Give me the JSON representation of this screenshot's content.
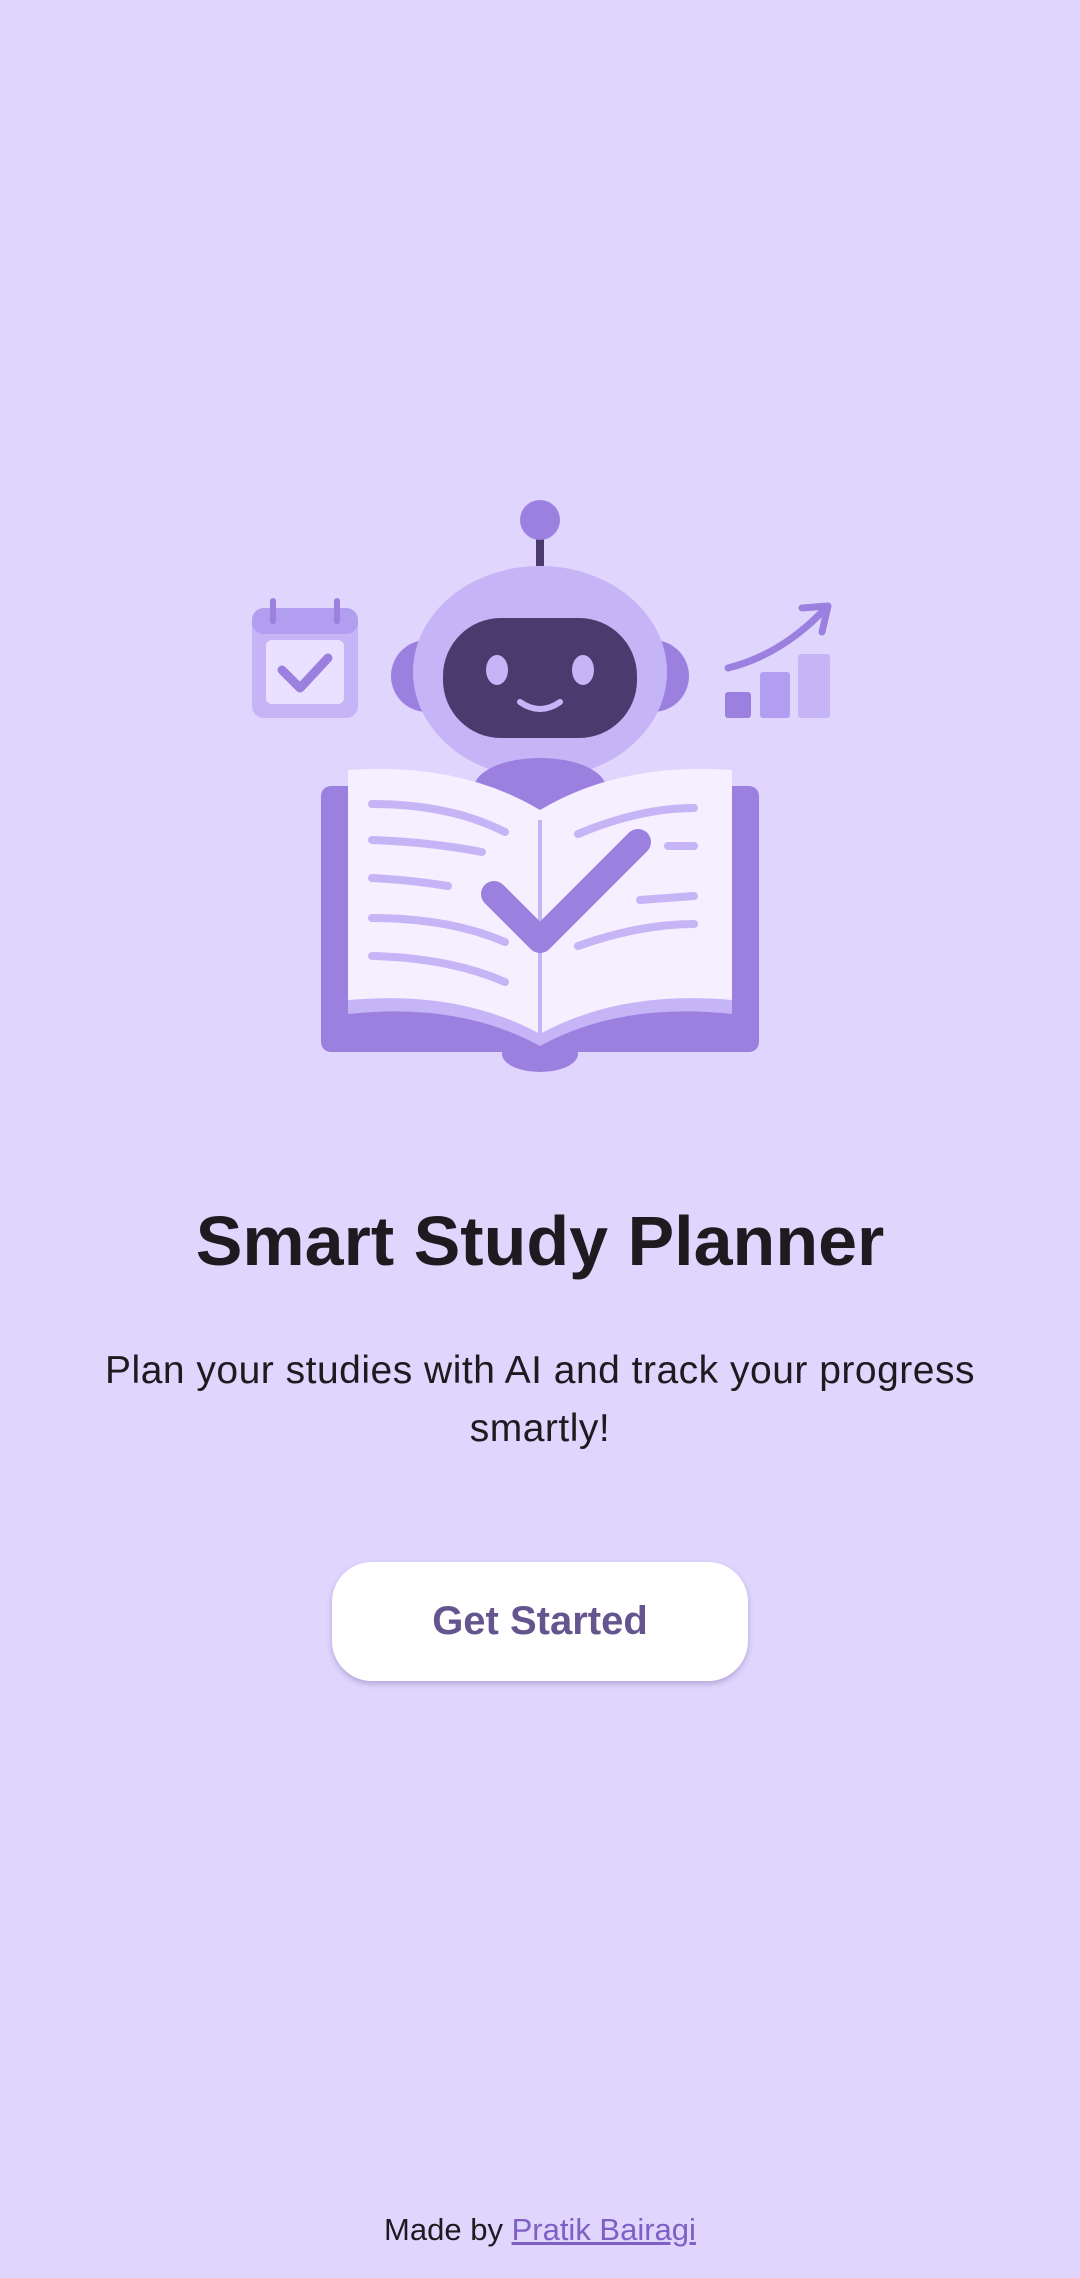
{
  "hero": {
    "icon": "robot-reading-book-illustration"
  },
  "title": "Smart Study Planner",
  "subtitle": "Plan your studies with AI and track your progress smartly!",
  "cta": {
    "label": "Get Started"
  },
  "footer": {
    "prefix": "Made by",
    "author": "Pratik Bairagi"
  },
  "colors": {
    "background": "#dfd5fd",
    "primary": "#65558f",
    "illustration_light": "#c5b5f6",
    "illustration_mid": "#9b80e0",
    "illustration_dark": "#4b3a6e",
    "link": "#7e5fc4"
  }
}
